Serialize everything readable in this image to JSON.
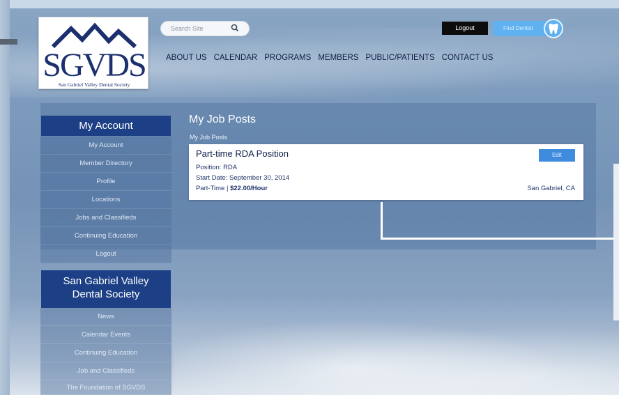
{
  "logo": {
    "letters": "SGVDS",
    "subtitle": "San Gabriel Valley Dental Society"
  },
  "search": {
    "placeholder": "Search Site"
  },
  "header": {
    "logout_label": "Logout",
    "find_dentist_label": "Find Dentist"
  },
  "nav": [
    "ABOUT US",
    "CALENDAR",
    "PROGRAMS",
    "MEMBERS",
    "PUBLIC/PATIENTS",
    "CONTACT US"
  ],
  "sidebar": {
    "account_title": "My Account",
    "account_items": [
      "My Account",
      "Member Directory",
      "Profile",
      "Locations",
      "Jobs and Classifieds",
      "Continuing Education",
      "Logout"
    ],
    "society_title": "San Gabriel Valley Dental Society",
    "society_items": [
      "News",
      "Calendar Events",
      "Continuing Education",
      "Job and Classifieds",
      "The Foundation of SGVDS"
    ]
  },
  "main": {
    "title": "My Job Posts",
    "subtitle": "My Job Posts",
    "job": {
      "title": "Part-time RDA Position",
      "edit_label": "Edit",
      "position": "Position: RDA",
      "start_date": "Start Date: September 30, 2014",
      "type": "Part-Time | ",
      "pay": "$22.00/Hour",
      "location": "San Gabriel, CA"
    }
  },
  "colors": {
    "brand_navy": "#1c3f85",
    "accent_blue": "#5fb1ef",
    "edit_blue": "#3f8cdf"
  }
}
